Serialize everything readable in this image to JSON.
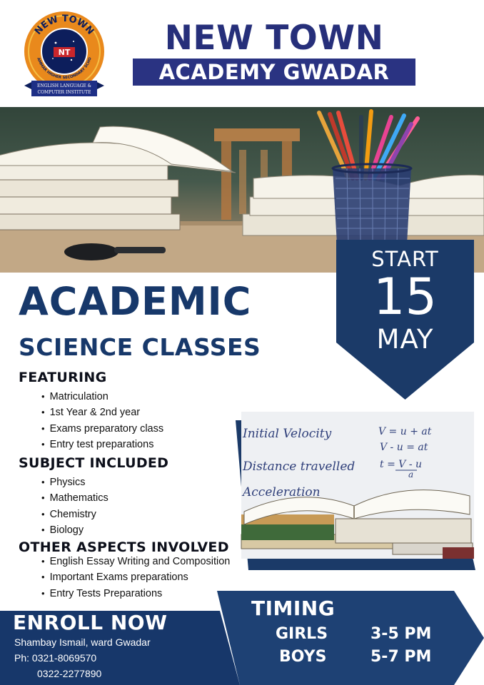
{
  "colors": {
    "navy": "#1b3a68",
    "band": "#2a3382",
    "title": "#262f7a",
    "logo_orange": "#e9891c"
  },
  "logo": {
    "ring_text": "NEW TOWN",
    "ring_text_lower": "GRAMMAR HIGHER SECONDARY SCHOOL",
    "monogram": "NT",
    "ribbon_line1": "ENGLISH LANGUAGE &",
    "ribbon_line2": "COMPUTER INSTITUTE"
  },
  "header": {
    "title": "NEW TOWN",
    "subtitle": "ACADEMY GWADAR"
  },
  "start": {
    "label": "START",
    "day": "15",
    "month": "MAY"
  },
  "heading": {
    "line1": "ACADEMIC",
    "line2": "SCIENCE CLASSES"
  },
  "featuring": {
    "title": "FEATURING",
    "items": [
      "Matriculation",
      "1st Year & 2nd year",
      "Exams preparatory class",
      "Entry test preparations"
    ]
  },
  "subjects": {
    "title": "SUBJECT INCLUDED",
    "items": [
      "Physics",
      "Mathematics",
      "Chemistry",
      "Biology"
    ]
  },
  "other": {
    "title": "OTHER ASPECTS INVOLVED",
    "items": [
      "English Essay Writing and Composition",
      "Important Exams preparations",
      "Entry Tests Preparations"
    ]
  },
  "board": {
    "line1_left": "Initial Velocity",
    "line1_right": "V = u + at",
    "line2_right": "V - u = at",
    "line3_left": "Distance travelled",
    "line3_right": "t = V - u",
    "line3_den": "a",
    "line4_left": "Acceleration"
  },
  "footer": {
    "enroll": "ENROLL NOW",
    "address": "Shambay Ismail, ward Gwadar",
    "phone1": "Ph: 0321-8069570",
    "phone2": "0322-2277890",
    "timing_title": "TIMING",
    "girls_label": "GIRLS",
    "girls_time": "3-5 PM",
    "boys_label": "BOYS",
    "boys_time": "5-7 PM"
  }
}
